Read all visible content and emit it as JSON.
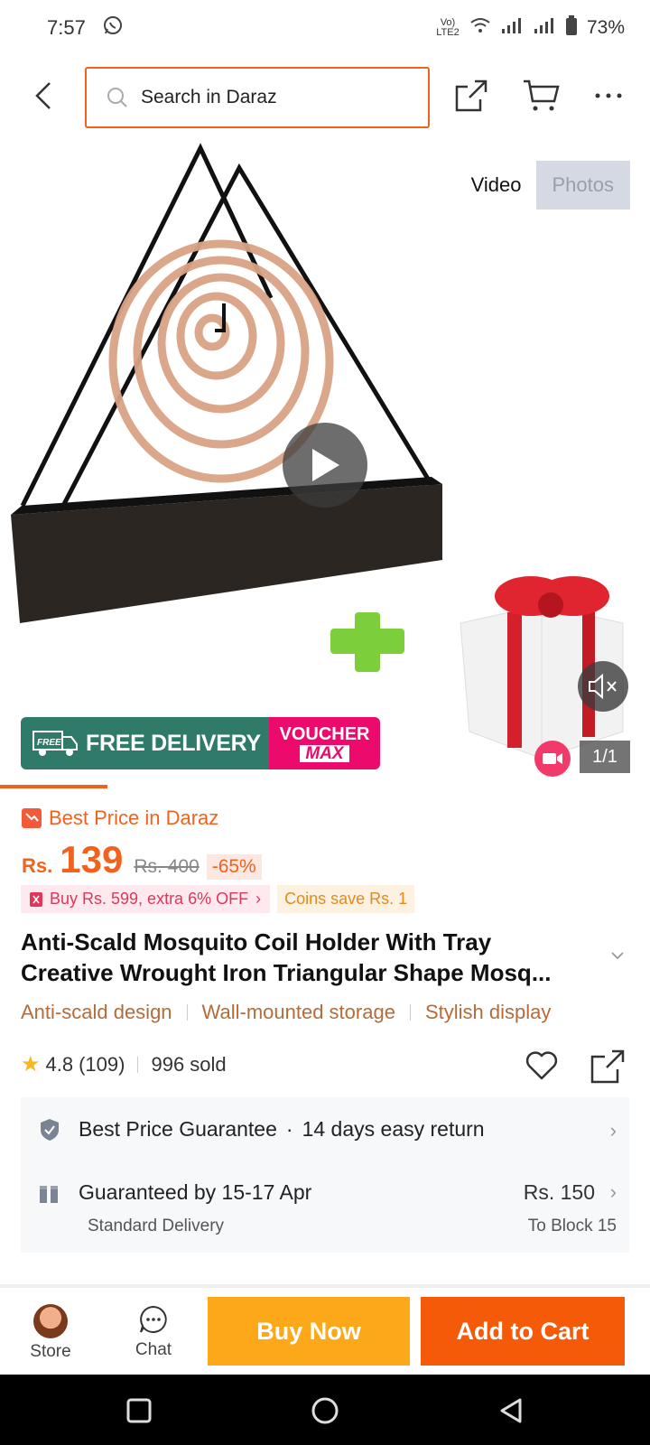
{
  "status_bar": {
    "time": "7:57",
    "network_label": "Vo) LTE2",
    "battery": "73%"
  },
  "top_nav": {
    "search_placeholder": "Search in Daraz"
  },
  "gallery": {
    "tab_video": "Video",
    "tab_photos": "Photos",
    "counter": "1/1",
    "promo_free_badge": "FREE",
    "promo_free_text": "FREE DELIVERY",
    "promo_voucher_line1": "VOUCHER",
    "promo_voucher_line2": "MAX",
    "progress_fraction": 0.165
  },
  "product": {
    "best_price_label": "Best Price in Daraz",
    "currency": "Rs.",
    "price": "139",
    "old_price": "Rs. 400",
    "discount": "-65%",
    "tag_buy": "Buy Rs. 599, extra 6% OFF",
    "tag_coins": "Coins save Rs. 1",
    "title_line1": "Anti-Scald Mosquito Coil Holder With Tray",
    "title_line2": "Creative Wrought Iron Triangular Shape Mosq...",
    "features": [
      "Anti-scald design",
      "Wall-mounted storage",
      "Stylish display"
    ],
    "rating": "4.8",
    "reviews": "(109)",
    "sold": "996 sold"
  },
  "services": {
    "guarantee": "Best Price Guarantee",
    "return": "14 days easy return",
    "delivery_title": "Guaranteed by 15-17 Apr",
    "delivery_type": "Standard Delivery",
    "delivery_price": "Rs. 150",
    "delivery_to": "To Block 15"
  },
  "bottom_bar": {
    "store_label": "Store",
    "chat_label": "Chat",
    "buy_now": "Buy Now",
    "add_to_cart": "Add to Cart"
  },
  "colors": {
    "accent": "#f2621d",
    "buy_now": "#fca819",
    "add_to_cart": "#f55a08",
    "free_delivery": "#2f7a68",
    "voucher": "#ec0a6d"
  }
}
